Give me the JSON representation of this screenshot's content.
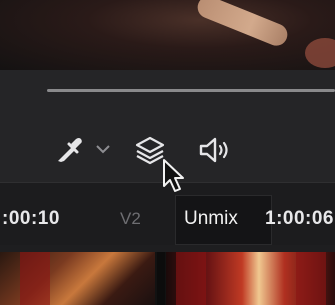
{
  "toolbar": {
    "eyedropper_icon": "eyedropper-icon",
    "dropdown_icon": "chevron-down-icon",
    "layers_icon": "layers-icon",
    "audio_icon": "speaker-icon"
  },
  "timeline": {
    "timecode_left": ":00:10",
    "track_label": "V2",
    "timecode_right": "1:00:06"
  },
  "tooltip": {
    "text": "Unmix"
  },
  "colors": {
    "toolbar_bg": "#252527",
    "icon_color": "#e6e6e8",
    "tooltip_bg": "#141416"
  }
}
